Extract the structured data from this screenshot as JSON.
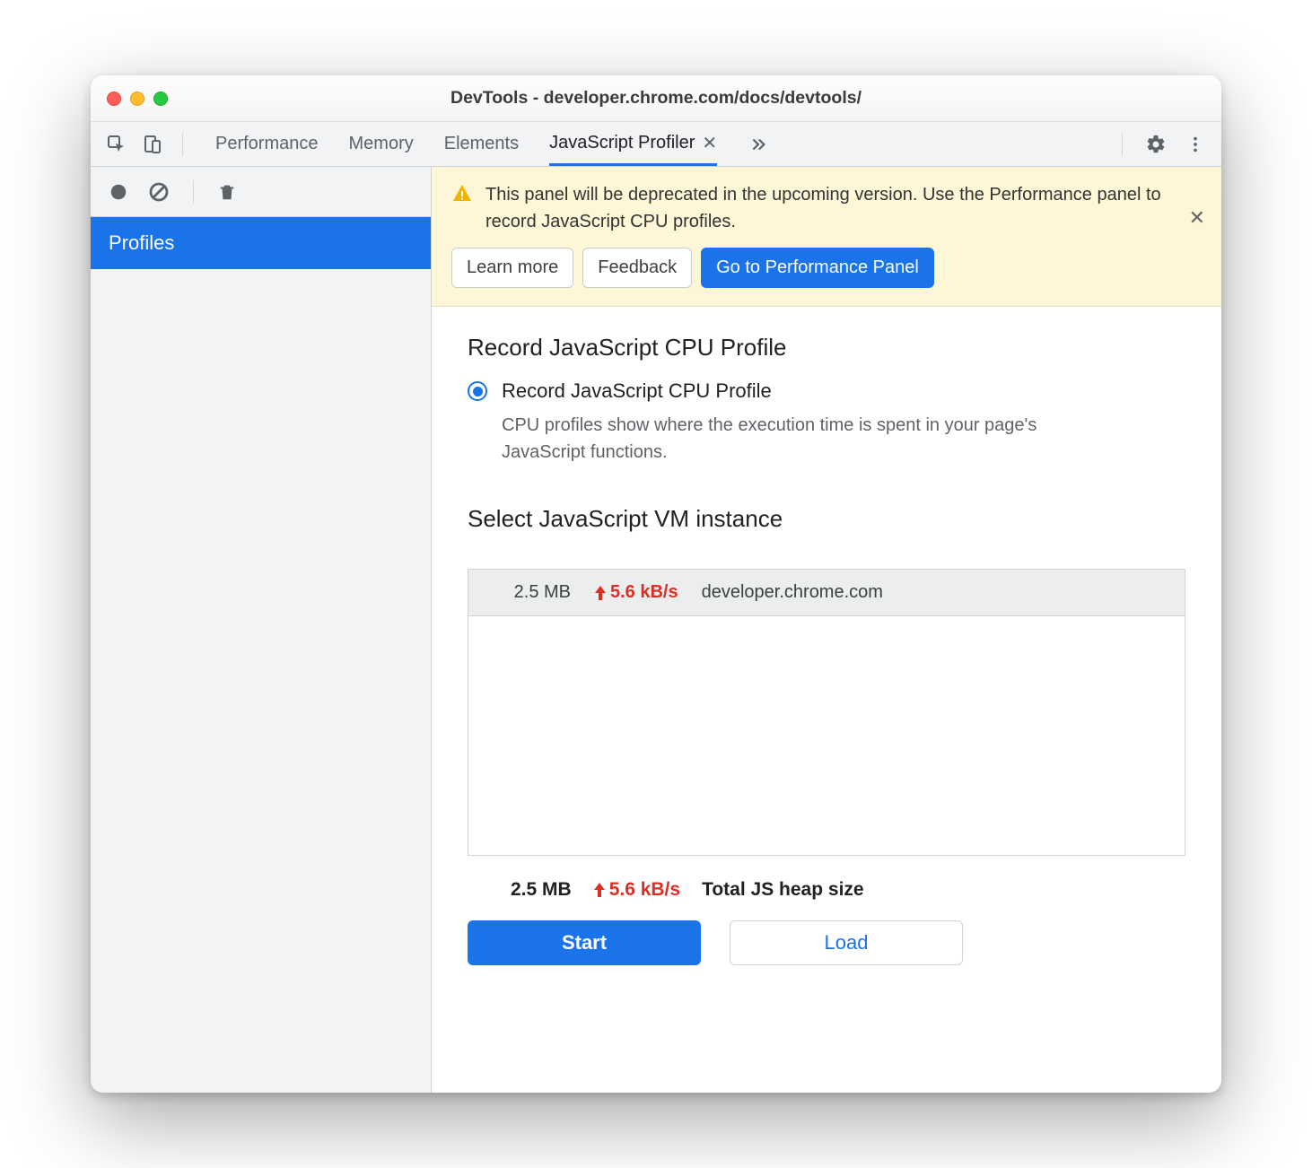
{
  "title": "DevTools - developer.chrome.com/docs/devtools/",
  "tabs": {
    "performance": "Performance",
    "memory": "Memory",
    "elements": "Elements",
    "profiler": "JavaScript Profiler"
  },
  "sidebar": {
    "item_profiles": "Profiles"
  },
  "banner": {
    "text": "This panel will be deprecated in the upcoming version. Use the Performance panel to record JavaScript CPU profiles.",
    "learn_more": "Learn more",
    "feedback": "Feedback",
    "goto": "Go to Performance Panel"
  },
  "record": {
    "heading": "Record JavaScript CPU Profile",
    "radio_label": "Record JavaScript CPU Profile",
    "hint": "CPU profiles show where the execution time is spent in your page's JavaScript functions."
  },
  "vm": {
    "heading": "Select JavaScript VM instance",
    "row": {
      "size": "2.5 MB",
      "rate": "5.6 kB/s",
      "host": "developer.chrome.com"
    },
    "total": {
      "size": "2.5 MB",
      "rate": "5.6 kB/s",
      "label": "Total JS heap size"
    }
  },
  "actions": {
    "start": "Start",
    "load": "Load"
  }
}
